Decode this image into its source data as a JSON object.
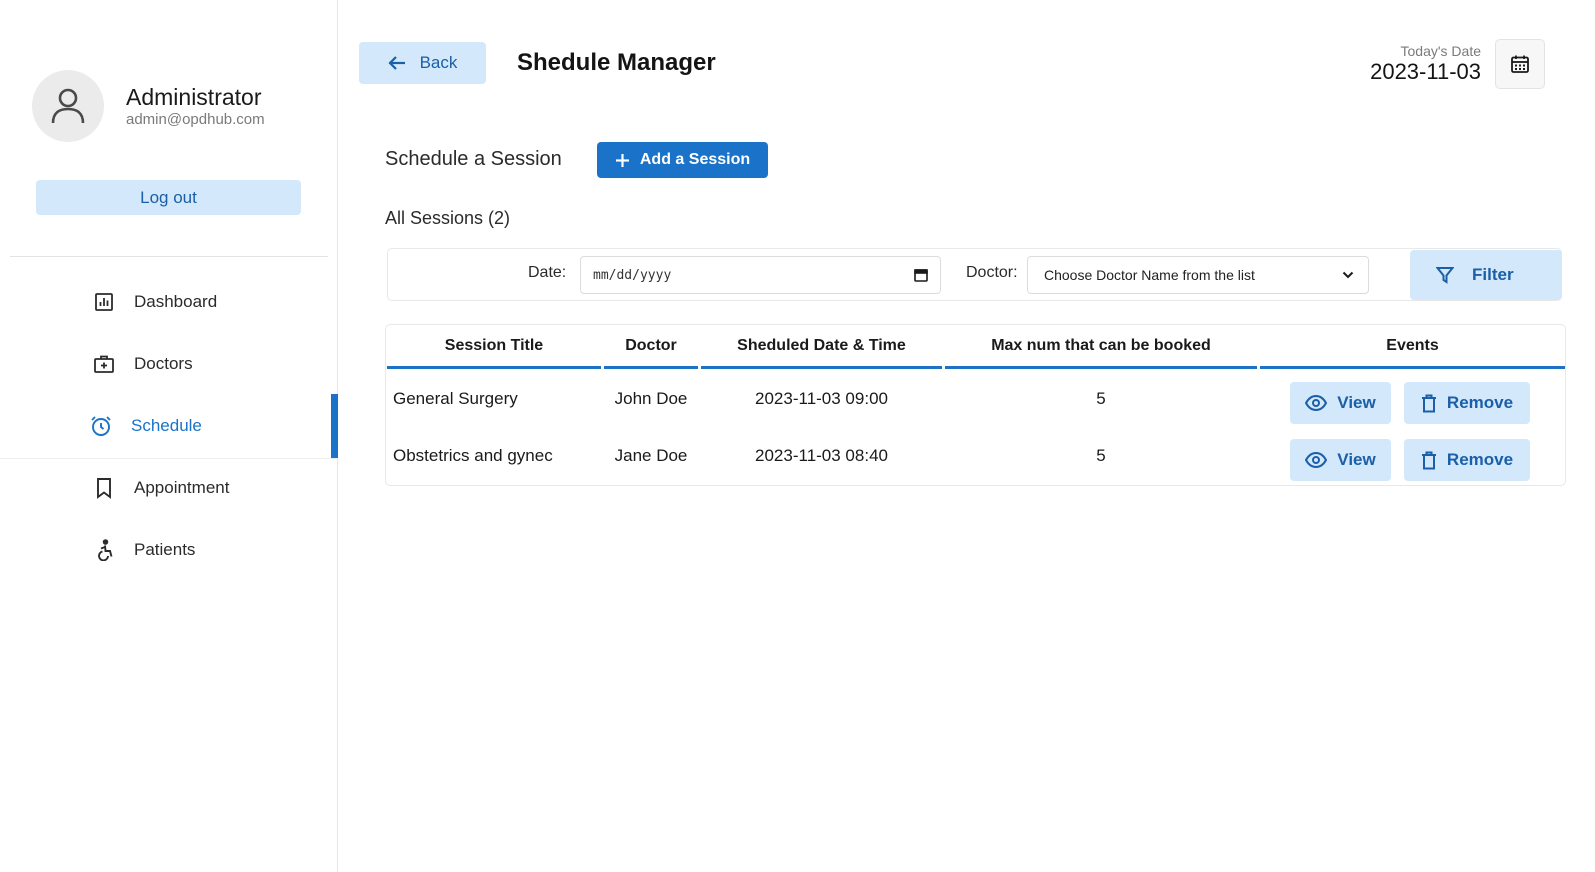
{
  "sidebar": {
    "profile": {
      "name": "Administrator",
      "email": "admin@opdhub.com"
    },
    "logout_label": "Log out",
    "items": [
      {
        "label": "Dashboard",
        "icon": "dashboard-icon"
      },
      {
        "label": "Doctors",
        "icon": "doctors-icon"
      },
      {
        "label": "Schedule",
        "icon": "alarm-clock-icon",
        "active": true
      },
      {
        "label": "Appointment",
        "icon": "bookmark-icon"
      },
      {
        "label": "Patients",
        "icon": "accessible-icon"
      }
    ]
  },
  "header": {
    "back_label": "Back",
    "title": "Shedule Manager",
    "today_label": "Today's Date",
    "today_value": "2023-11-03"
  },
  "section": {
    "schedule_label": "Schedule a Session",
    "add_label": "Add a Session",
    "all_sessions_label": "All Sessions (2)"
  },
  "filter": {
    "date_label": "Date:",
    "date_placeholder": "mm/dd/yyyy",
    "doctor_label": "Doctor:",
    "doctor_selected": "Choose Doctor Name from the list",
    "filter_label": "Filter"
  },
  "table": {
    "headers": [
      "Session Title",
      "Doctor",
      "Sheduled Date & Time",
      "Max num that can be booked",
      "Events"
    ],
    "rows": [
      {
        "title": "General Surgery",
        "doctor": "John Doe",
        "datetime": "2023-11-03 09:00",
        "max": "5"
      },
      {
        "title": "Obstetrics and gynec",
        "doctor": "Jane Doe",
        "datetime": "2023-11-03 08:40",
        "max": "5"
      }
    ],
    "view_label": "View",
    "remove_label": "Remove"
  },
  "colors": {
    "accent": "#1a73c8",
    "accent_light": "#d3e8fb",
    "accent_text": "#1a5fa8"
  }
}
